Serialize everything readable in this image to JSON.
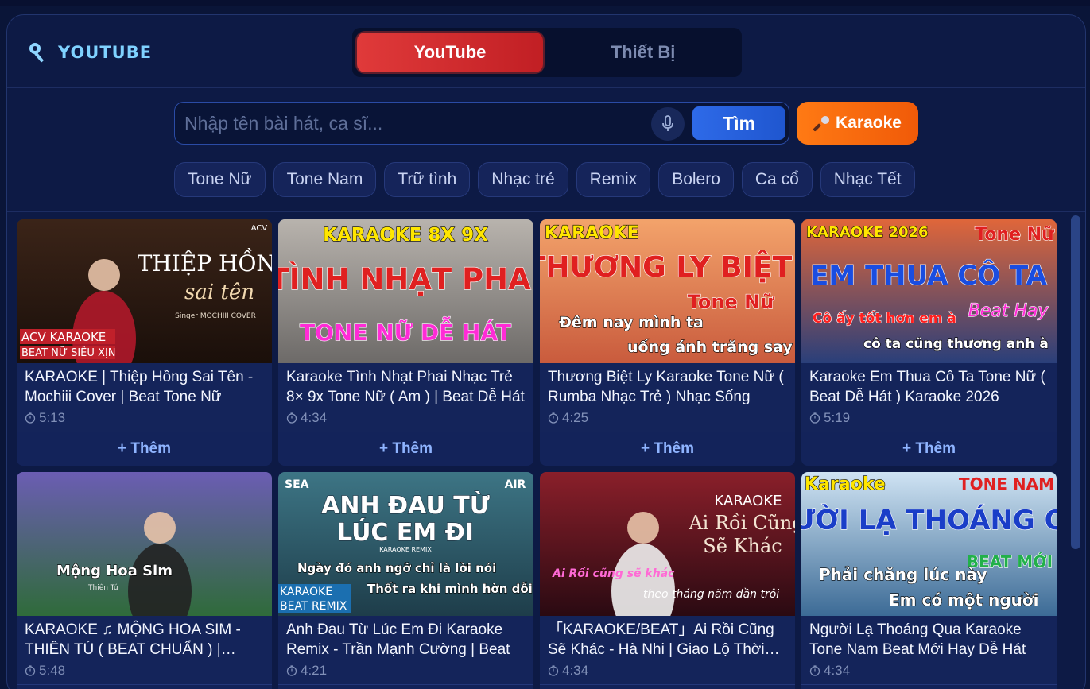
{
  "brand": {
    "title": "YOUTUBE",
    "icon": "search-key-icon"
  },
  "tabs": [
    {
      "label": "YouTube",
      "active": true
    },
    {
      "label": "Thiết Bị",
      "active": false
    }
  ],
  "search": {
    "placeholder": "Nhập tên bài hát, ca sĩ...",
    "value": "",
    "button": "Tìm",
    "mic_icon": "microphone-icon"
  },
  "karaoke_button": {
    "label": "Karaoke",
    "icon": "microphone-icon"
  },
  "filters": [
    "Tone Nữ",
    "Tone Nam",
    "Trữ tình",
    "Nhạc trẻ",
    "Remix",
    "Bolero",
    "Ca cổ",
    "Nhạc Tết"
  ],
  "add_label": "+ Thêm",
  "colors": {
    "accent_red": "#e03a3a",
    "accent_orange": "#ff7a14",
    "accent_blue": "#2e6ae8",
    "panel": "#0d1a45"
  },
  "videos": [
    {
      "title": "KARAOKE | Thiệp Hồng Sai Tên - Mochiii Cover | Beat Tone Nữ",
      "duration": "5:13",
      "thumb": {
        "bg1": "#3b2418",
        "bg2": "#1a0f0a",
        "line1": "THIỆP HỒNG",
        "line2": "sai tên",
        "line3": "Singer MOCHIII COVER",
        "badge1": "ACV KARAOKE",
        "badge2": "BEAT NỮ SIÊU XỊN",
        "corner": "ACV"
      }
    },
    {
      "title": "Karaoke Tình Nhạt Phai Nhạc Trẻ 8× 9x Tone Nữ ( Am ) | Beat Dễ Hát",
      "duration": "4:34",
      "thumb": {
        "bg1": "#b8b3ad",
        "bg2": "#6d6a68",
        "line1": "KARAOKE 8X 9X",
        "line2": "TÌNH NHẠT PHAI",
        "line3": "TONE NỮ DỄ HÁT"
      }
    },
    {
      "title": "Thương Biệt Ly Karaoke Tone Nữ ( Rumba Nhạc Trẻ ) Nhạc Sống",
      "duration": "4:25",
      "thumb": {
        "bg1": "#f3a36b",
        "bg2": "#c95b3d",
        "line1": "KARAOKE",
        "line2": "THƯƠNG LY BIỆT",
        "line3": "Tone Nữ",
        "line4": "Đêm nay mình ta",
        "line5": "uống ánh trăng say"
      }
    },
    {
      "title": "Karaoke Em Thua Cô Ta Tone Nữ ( Beat Dễ Hát ) Karaoke 2026",
      "duration": "5:19",
      "thumb": {
        "bg1": "#e0663a",
        "bg2": "#2a3f7a",
        "line1": "KARAOKE 2026",
        "line2": "EM THUA CÔ TA",
        "line3": "Tone Nữ",
        "line4": "Cô ấy tốt hơn em à",
        "line5": "cô ta cũng thương anh à",
        "line6": "Beat Hay"
      }
    },
    {
      "title": "KARAOKE ♫ MỘNG HOA SIM - THIÊN TÚ ( BEAT CHUẨN ) | Karaoke",
      "duration": "5:48",
      "thumb": {
        "bg1": "#6b5db3",
        "bg2": "#2f6b3a",
        "line1": "Mộng Hoa Sim",
        "line2": "Thiên Tú"
      }
    },
    {
      "title": "Anh Đau Từ Lúc Em Đi Karaoke Remix - Trần Mạnh Cường | Beat",
      "duration": "4:21",
      "thumb": {
        "bg1": "#3d7585",
        "bg2": "#1e3d4a",
        "line1": "ANH ĐAU TỪ",
        "line2": "LÚC EM ĐI",
        "line3": "KARAOKE REMIX",
        "line4": "Ngày đó anh ngỡ chỉ là lời nói",
        "line5": "Thốt ra khi mình hờn dỗi",
        "badge1": "KARAOKE",
        "badge2": "BEAT REMIX",
        "corner": "SEA",
        "corner2": "AIR"
      }
    },
    {
      "title": "「KARAOKE/BEAT」Ai Rồi Cũng Sẽ Khác - Hà Nhi | Giao Lộ Thời Gian",
      "duration": "4:34",
      "thumb": {
        "bg1": "#8a1f2a",
        "bg2": "#2a0a12",
        "line1": "KARAOKE",
        "line2": "Ai Rồi Cũng",
        "line3": "Sẽ Khác",
        "line4": "Ai Rồi cũng sẽ khác",
        "line5": "theo tháng năm dần trôi"
      }
    },
    {
      "title": "Người Lạ Thoáng Qua Karaoke Tone Nam Beat Mới Hay Dễ Hát",
      "duration": "4:34",
      "thumb": {
        "bg1": "#cfe3f3",
        "bg2": "#3c6b96",
        "line1": "Karaoke",
        "line2": "NGƯỜI LẠ THOÁNG QUA",
        "line3": "TONE NAM",
        "line4": "Phải chăng lúc này",
        "line5": "Em có một người",
        "line6": "BEAT MỚI"
      }
    }
  ]
}
